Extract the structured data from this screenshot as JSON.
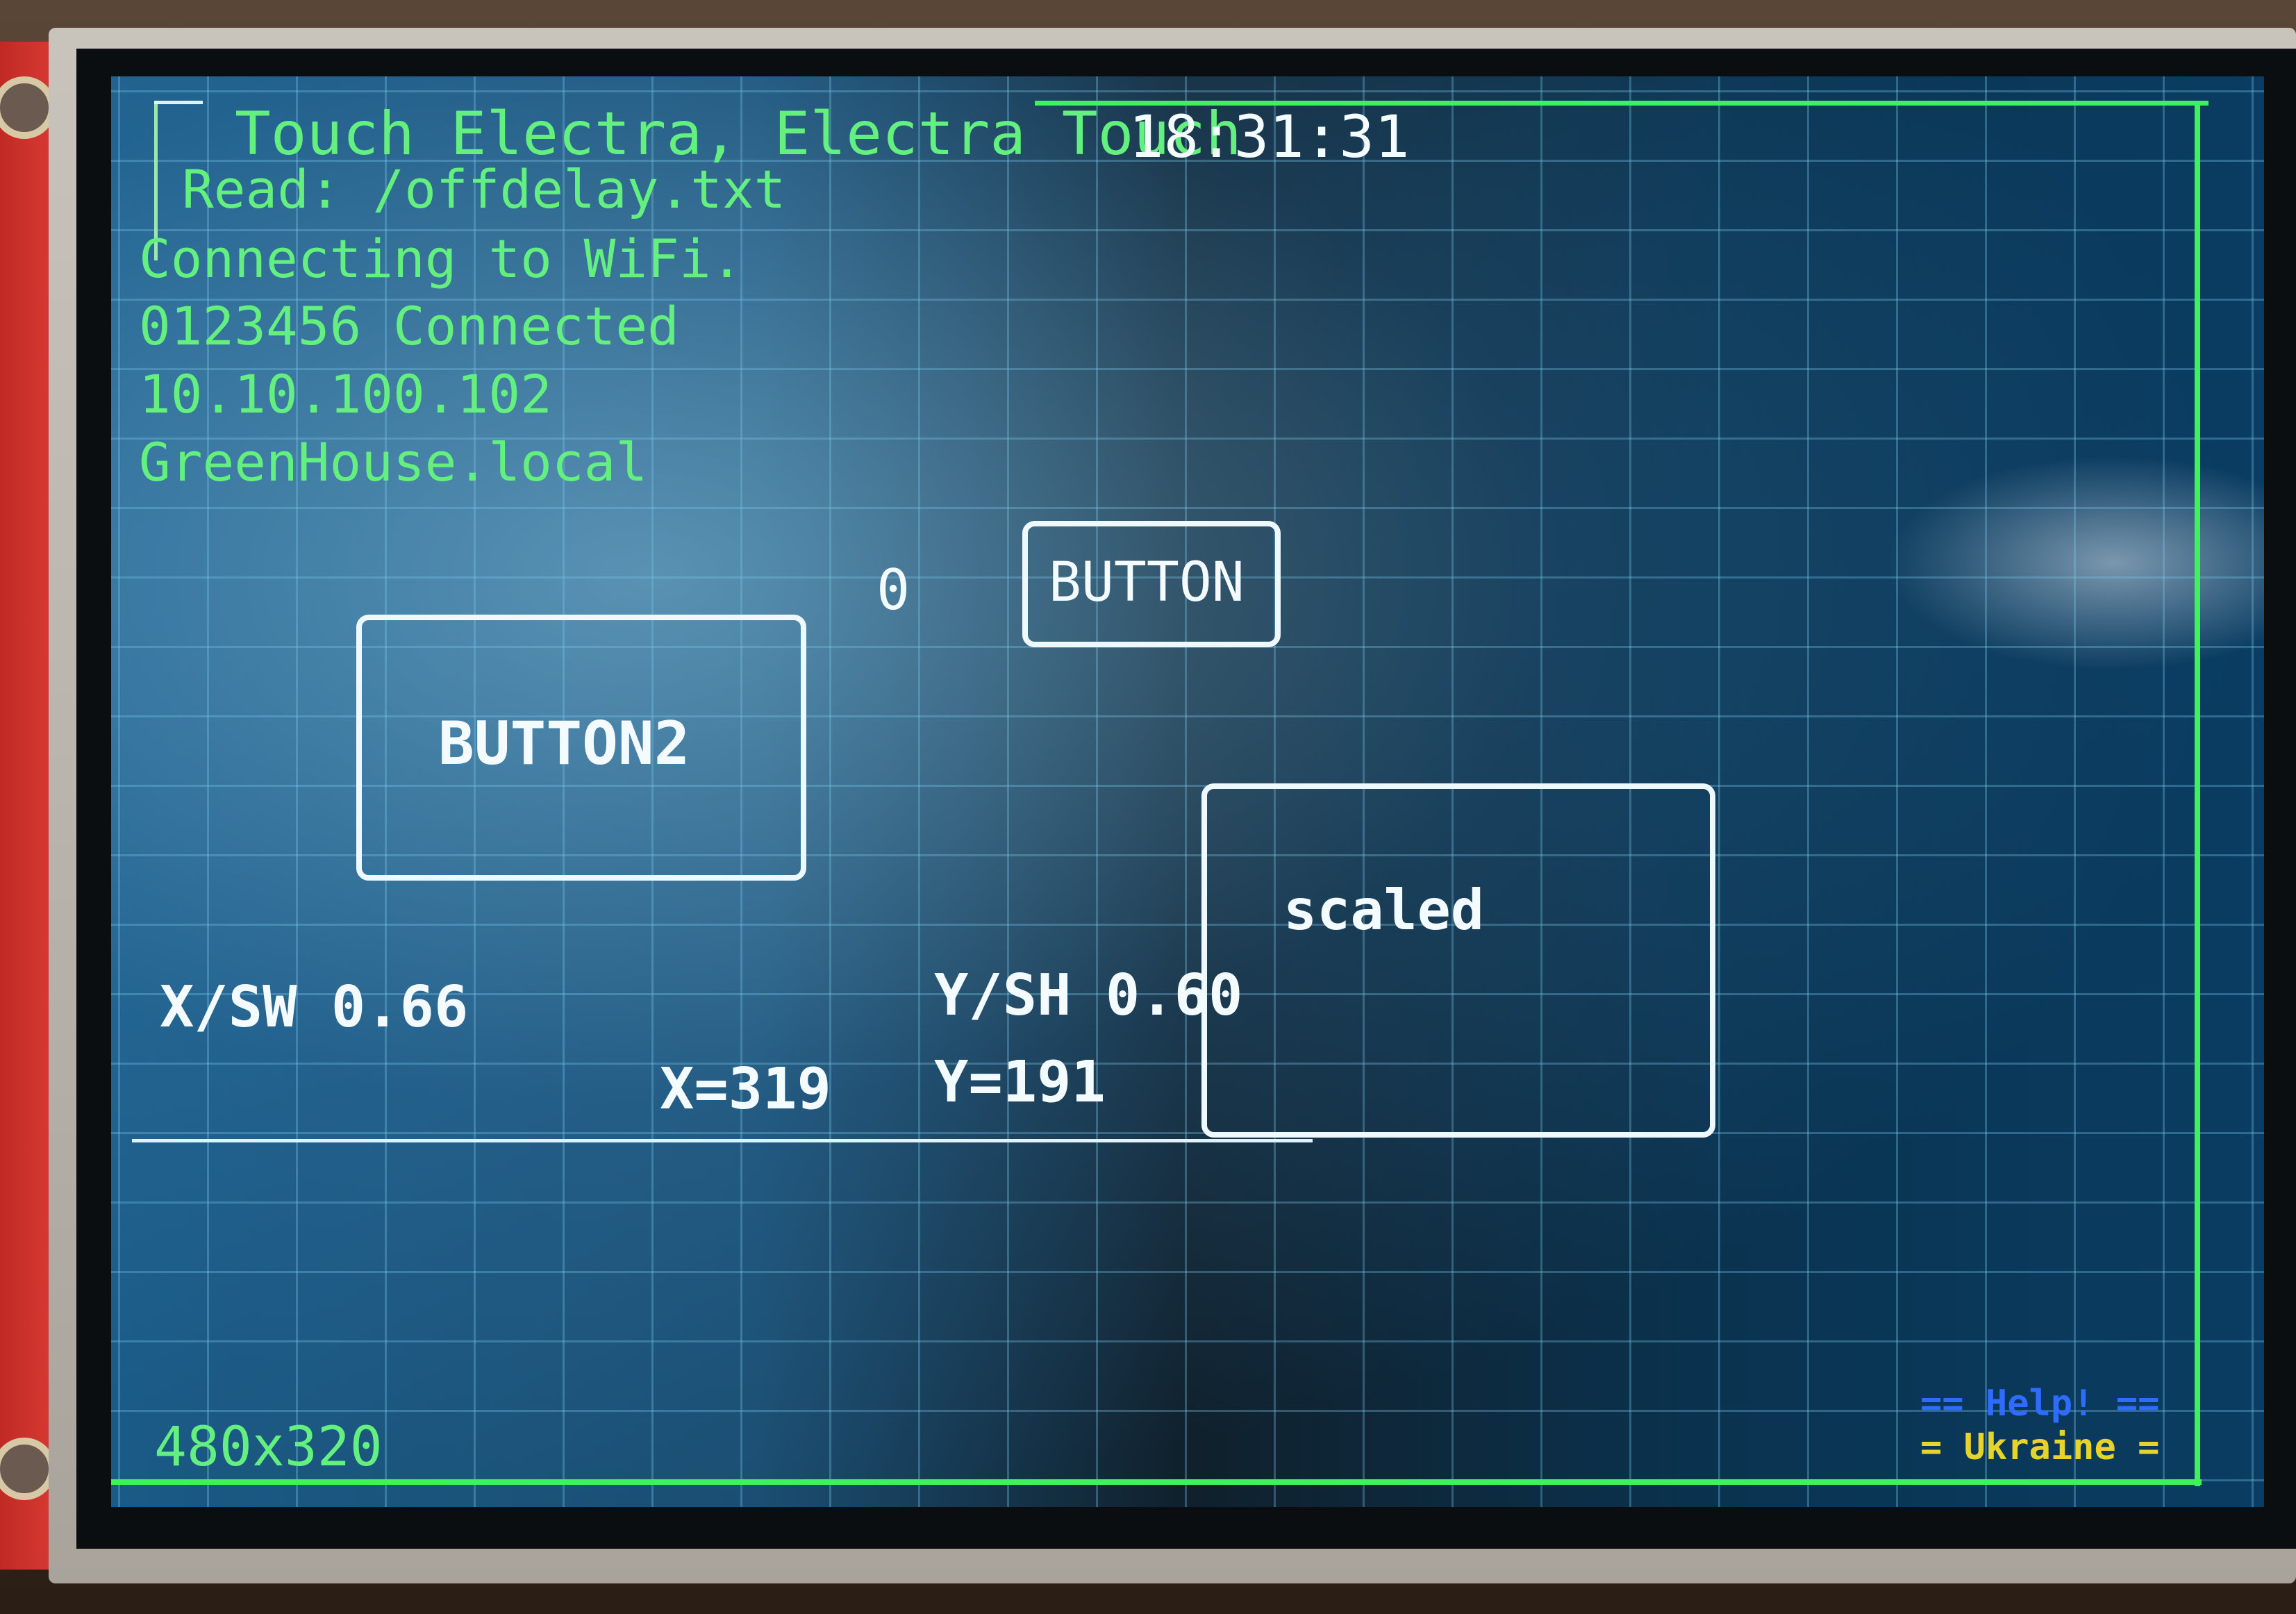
{
  "header": {
    "title": "Touch Electra, Electra Touch",
    "clock": "18:31:31"
  },
  "log": {
    "line1": "Read: /offdelay.txt",
    "line2": "Connecting to WiFi.",
    "line3": "0123456 Connected",
    "line4": "10.10.100.102",
    "line5": "GreenHouse.local"
  },
  "counter": "0",
  "buttons": {
    "button": "BUTTON",
    "button2": "BUTTON2",
    "scaled": "scaled"
  },
  "readouts": {
    "x_sw": "X/SW 0.66",
    "y_sh": "Y/SH 0.60",
    "x": "X=319",
    "y": "Y=191"
  },
  "footer": {
    "resolution": "480x320",
    "help": "== Help! ==",
    "ukraine": "= Ukraine ="
  },
  "colors": {
    "frame": "#3df25a",
    "text_green": "#63f07f",
    "text_white": "#f4fbff",
    "help_blue": "#2e6cff",
    "ukraine_yellow": "#e7d42b"
  }
}
